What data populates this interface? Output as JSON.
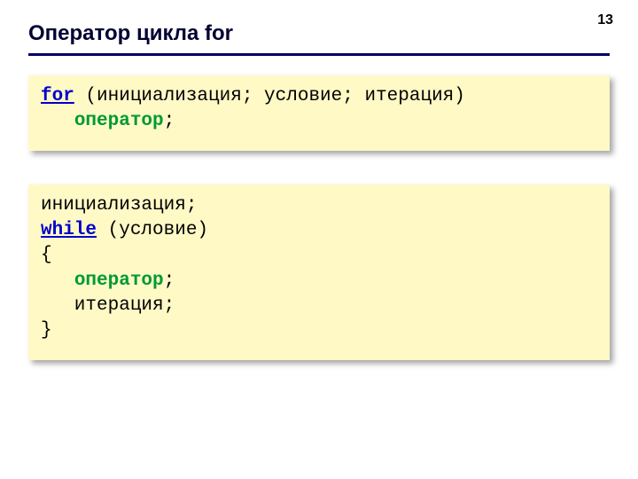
{
  "page_number": "13",
  "title": "Оператор цикла for",
  "code1": {
    "kw_for": "for",
    "for_args": " (инициализация; условие; итерация)",
    "indent": "   ",
    "operator": "оператор",
    "semicolon": ";"
  },
  "code2": {
    "line1": "инициализация;",
    "kw_while": "while",
    "while_args": " (условие)",
    "lbrace": "{",
    "indent": "   ",
    "operator": "оператор",
    "semicolon": ";",
    "iter_line": "   итерация;",
    "rbrace": "}"
  }
}
